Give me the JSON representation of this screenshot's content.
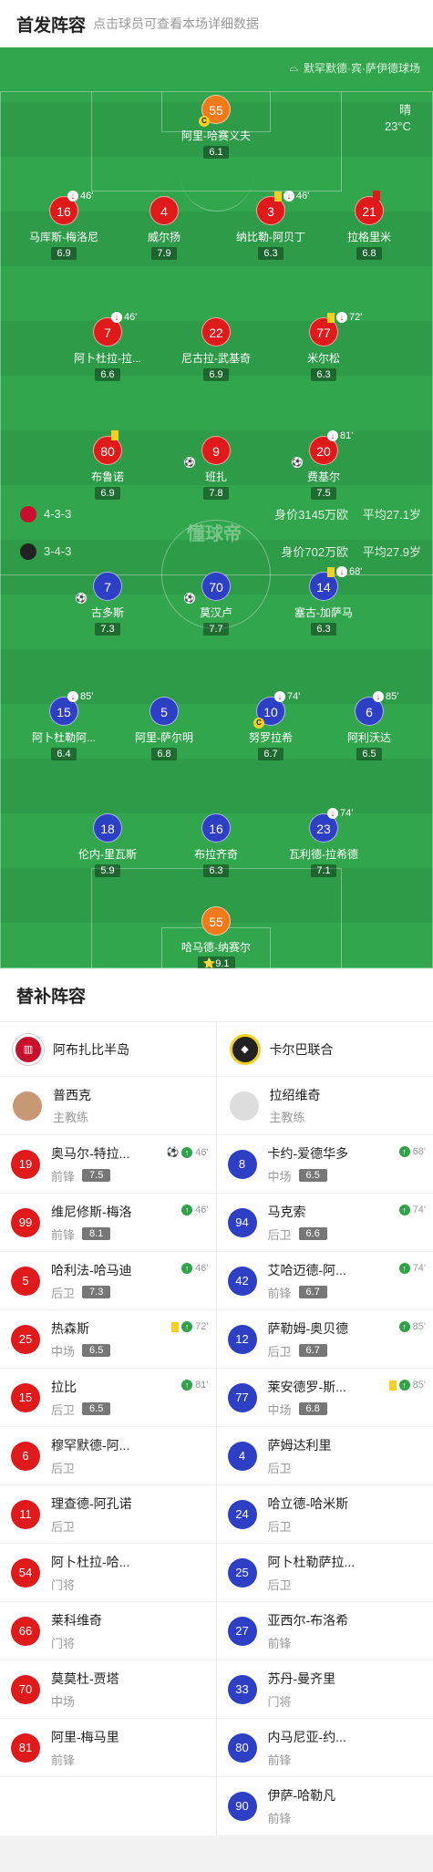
{
  "header": {
    "title": "首发阵容",
    "subtitle": "点击球员可查看本场详细数据"
  },
  "pitch": {
    "venue": "默罕默德·宾·萨伊德球场",
    "weather": "晴",
    "temperature": "23°C",
    "watermark": "懂球帝",
    "home_formation": "4-3-3",
    "home_value": "身价3145万欧",
    "home_age": "平均27.1岁",
    "away_formation": "3-4-3",
    "away_value": "身价702万欧",
    "away_age": "平均27.9岁"
  },
  "home_players": [
    {
      "num": "55",
      "name": "阿里-哈赛义夫",
      "rating": "6.1",
      "color": "orange",
      "captain": "C"
    },
    {
      "num": "16",
      "name": "马库斯-梅洛尼",
      "rating": "6.9",
      "color": "red",
      "sub_min": "46'"
    },
    {
      "num": "4",
      "name": "威尔扬",
      "rating": "7.9",
      "color": "red"
    },
    {
      "num": "3",
      "name": "纳比勒-阿贝丁",
      "rating": "6.3",
      "color": "red",
      "sub_min": "46'",
      "card": "yellow"
    },
    {
      "num": "21",
      "name": "拉格里米",
      "rating": "6.8",
      "color": "red",
      "card": "red"
    },
    {
      "num": "7",
      "name": "阿卜杜拉-拉...",
      "rating": "6.6",
      "color": "red",
      "sub_min": "46'"
    },
    {
      "num": "22",
      "name": "尼古拉-武基奇",
      "rating": "6.9",
      "color": "red"
    },
    {
      "num": "77",
      "name": "米尔松",
      "rating": "6.3",
      "color": "red",
      "sub_min": "72'",
      "card": "yellow"
    },
    {
      "num": "80",
      "name": "布鲁诺",
      "rating": "6.9",
      "color": "red",
      "card": "yellow"
    },
    {
      "num": "9",
      "name": "班扎",
      "rating": "7.8",
      "color": "red",
      "goal": "⚽"
    },
    {
      "num": "20",
      "name": "费基尔",
      "rating": "7.5",
      "color": "red",
      "sub_min": "81'",
      "goal": "⚽"
    }
  ],
  "away_players": [
    {
      "num": "7",
      "name": "古多斯",
      "rating": "7.3",
      "color": "blue",
      "goal": "⚽"
    },
    {
      "num": "70",
      "name": "莫汉卢",
      "rating": "7.7",
      "color": "blue",
      "goal": "⚽"
    },
    {
      "num": "14",
      "name": "塞古-加萨马",
      "rating": "6.3",
      "color": "blue",
      "sub_min": "68'",
      "card": "yellow"
    },
    {
      "num": "15",
      "name": "阿卜杜勒阿...",
      "rating": "6.4",
      "color": "blue",
      "sub_min": "85'"
    },
    {
      "num": "5",
      "name": "阿里-萨尔明",
      "rating": "6.8",
      "color": "blue"
    },
    {
      "num": "10",
      "name": "努罗拉希",
      "rating": "6.7",
      "color": "blue",
      "sub_min": "74'",
      "captain": "C"
    },
    {
      "num": "6",
      "name": "阿利沃达",
      "rating": "6.5",
      "color": "blue",
      "sub_min": "85'"
    },
    {
      "num": "18",
      "name": "伦内-里瓦斯",
      "rating": "5.9",
      "color": "blue"
    },
    {
      "num": "16",
      "name": "布拉齐奇",
      "rating": "6.3",
      "color": "blue"
    },
    {
      "num": "23",
      "name": "瓦利德-拉希德",
      "rating": "7.1",
      "color": "blue",
      "sub_min": "74'"
    },
    {
      "num": "55",
      "name": "哈马德-纳赛尔",
      "rating": "9.1",
      "color": "orange",
      "star": "⭐"
    }
  ],
  "subs_title": "替补阵容",
  "home_team": {
    "name": "阿布扎比半岛",
    "coach": "普西克",
    "coach_role": "主教练",
    "logo_color": "#c8102e"
  },
  "away_team": {
    "name": "卡尔巴联合",
    "coach": "拉绍维奇",
    "coach_role": "主教练",
    "logo_color": "#222222"
  },
  "home_subs": [
    {
      "num": "19",
      "name": "奥马尔-特拉...",
      "pos": "前锋",
      "rating": "7.5",
      "event": "46'",
      "goal": "⚽"
    },
    {
      "num": "99",
      "name": "维尼修斯-梅洛",
      "pos": "前锋",
      "rating": "8.1",
      "event": "46'"
    },
    {
      "num": "5",
      "name": "哈利法-哈马迪",
      "pos": "后卫",
      "rating": "7.3",
      "event": "46'"
    },
    {
      "num": "25",
      "name": "热森斯",
      "pos": "中场",
      "rating": "6.5",
      "event": "72'",
      "card": "yellow"
    },
    {
      "num": "15",
      "name": "拉比",
      "pos": "后卫",
      "rating": "6.5",
      "event": "81'"
    },
    {
      "num": "6",
      "name": "穆罕默德-阿...",
      "pos": "后卫"
    },
    {
      "num": "11",
      "name": "理查德-阿孔诺",
      "pos": "后卫"
    },
    {
      "num": "54",
      "name": "阿卜杜拉-哈...",
      "pos": "门将"
    },
    {
      "num": "66",
      "name": "莱科维奇",
      "pos": "门将"
    },
    {
      "num": "70",
      "name": "莫莫杜-贾塔",
      "pos": "中场"
    },
    {
      "num": "81",
      "name": "阿里-梅马里",
      "pos": "前锋"
    }
  ],
  "away_subs": [
    {
      "num": "8",
      "name": "卡约-爱德华多",
      "pos": "中场",
      "rating": "6.5",
      "event": "68'"
    },
    {
      "num": "94",
      "name": "马克索",
      "pos": "后卫",
      "rating": "6.6",
      "event": "74'"
    },
    {
      "num": "42",
      "name": "艾哈迈德-阿...",
      "pos": "前锋",
      "rating": "6.7",
      "event": "74'"
    },
    {
      "num": "12",
      "name": "萨勒姆-奥贝德",
      "pos": "后卫",
      "rating": "6.7",
      "event": "85'"
    },
    {
      "num": "77",
      "name": "莱安德罗-斯...",
      "pos": "中场",
      "rating": "6.8",
      "event": "85'",
      "card": "yellow"
    },
    {
      "num": "4",
      "name": "萨姆达利里",
      "pos": "后卫"
    },
    {
      "num": "24",
      "name": "哈立德-哈米斯",
      "pos": "后卫"
    },
    {
      "num": "25",
      "name": "阿卜杜勒萨拉...",
      "pos": "后卫"
    },
    {
      "num": "27",
      "name": "亚西尔-布洛希",
      "pos": "前锋"
    },
    {
      "num": "33",
      "name": "苏丹-曼齐里",
      "pos": "门将"
    },
    {
      "num": "80",
      "name": "内马尼亚-约...",
      "pos": "前锋"
    },
    {
      "num": "90",
      "name": "伊萨-哈勒凡",
      "pos": "前锋"
    }
  ]
}
